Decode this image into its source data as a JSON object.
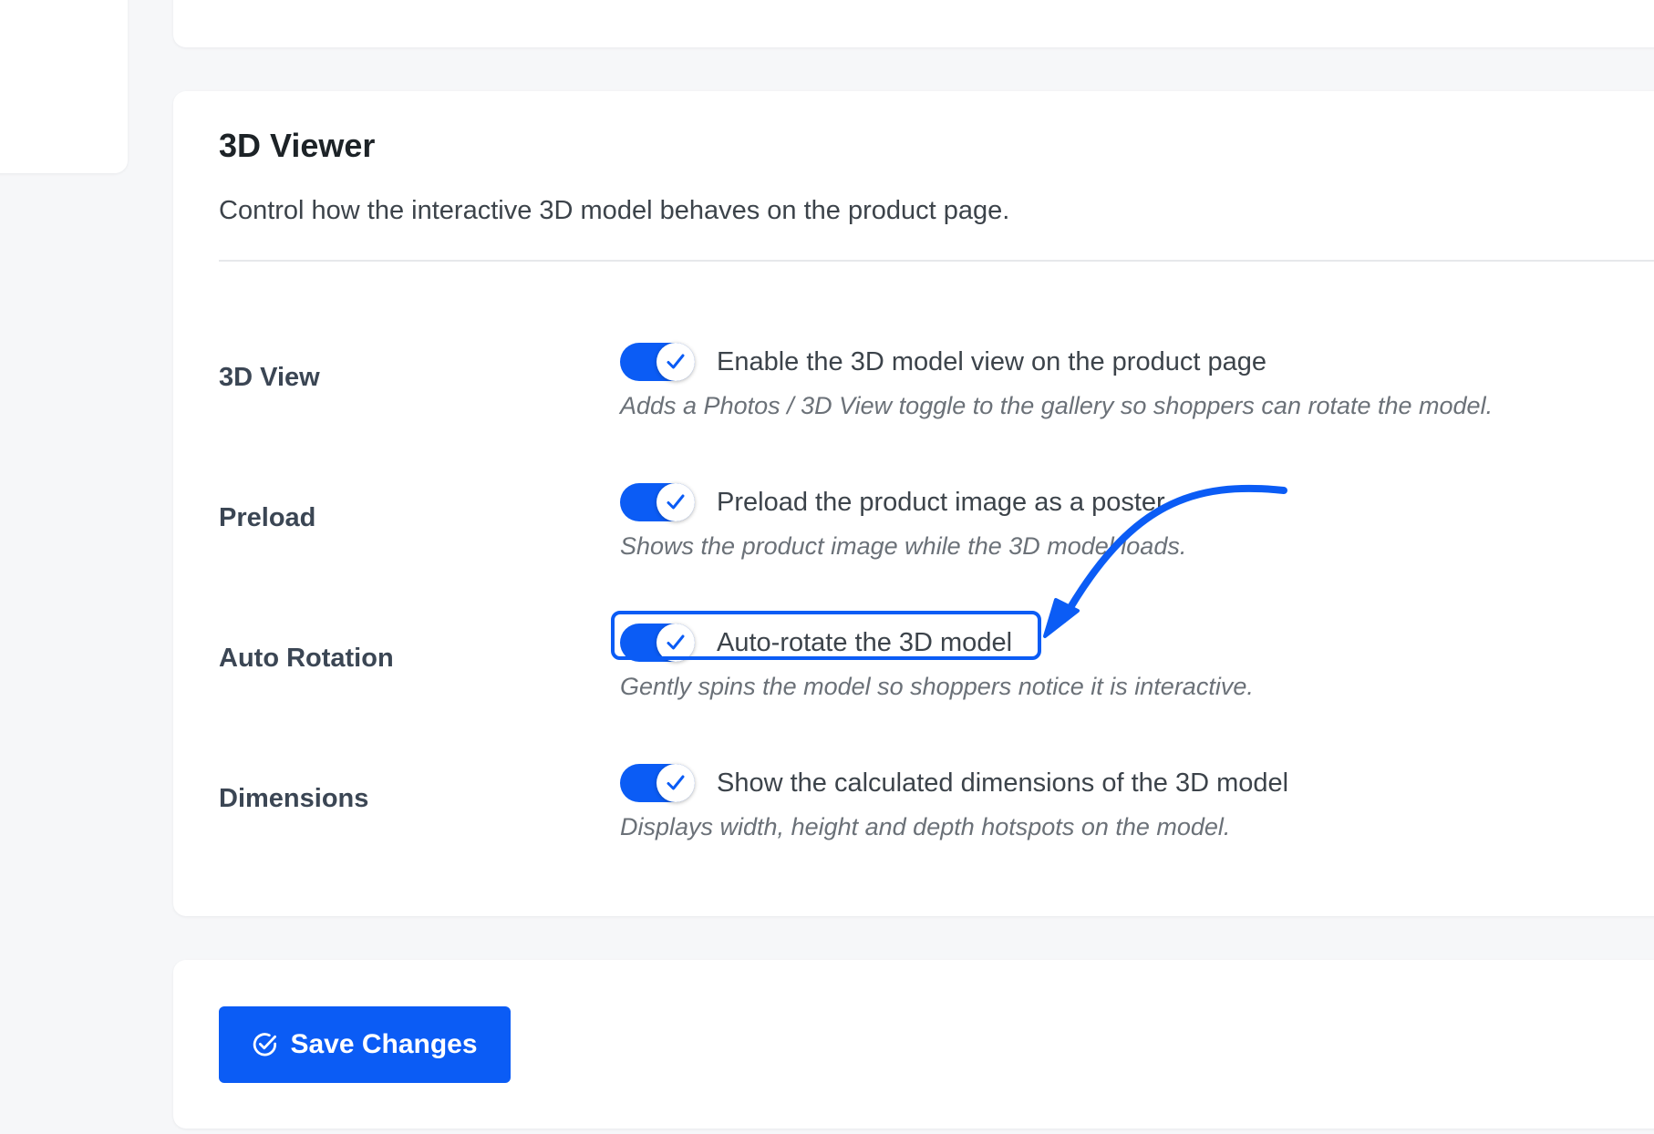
{
  "section": {
    "title": "3D Viewer",
    "description": "Control how the interactive 3D model behaves on the product page."
  },
  "settings": [
    {
      "label": "3D View",
      "toggle_text": "Enable the 3D model view on the product page",
      "hint": "Adds a Photos / 3D View toggle to the gallery so shoppers can rotate the model.",
      "enabled": true
    },
    {
      "label": "Preload",
      "toggle_text": "Preload the product image as a poster",
      "hint": "Shows the product image while the 3D model loads.",
      "enabled": true
    },
    {
      "label": "Auto Rotation",
      "toggle_text": "Auto-rotate the 3D model",
      "hint": "Gently spins the model so shoppers notice it is interactive.",
      "enabled": true,
      "highlighted": true
    },
    {
      "label": "Dimensions",
      "toggle_text": "Show the calculated dimensions of the 3D model",
      "hint": "Displays width, height and depth hotspots on the model.",
      "enabled": true
    }
  ],
  "save_button": {
    "label": "Save Changes",
    "icon": "check-circle-icon"
  },
  "annotation": {
    "type": "curved-arrow",
    "target": "Auto Rotation toggle"
  },
  "colors": {
    "accent": "#0b5cf5",
    "background": "#f6f7f9",
    "card": "#ffffff",
    "label": "#3b4654",
    "hint": "#6b7178"
  }
}
